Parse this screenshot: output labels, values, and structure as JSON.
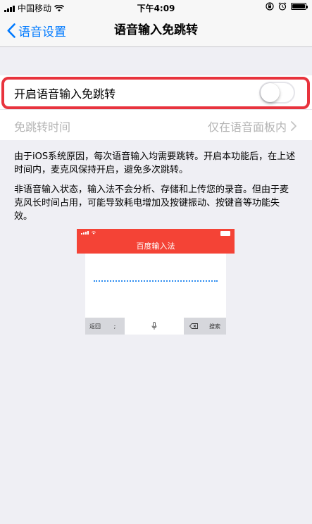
{
  "status_bar": {
    "carrier": "中国移动",
    "time": "下午4:09"
  },
  "nav": {
    "back_label": "语音设置",
    "title": "语音输入免跳转"
  },
  "settings": {
    "toggle_label": "开启语音输入免跳转",
    "toggle_on": false,
    "time_label": "免跳转时间",
    "time_value": "仅在语音面板内"
  },
  "description": {
    "paragraph1": "由于iOS系统原因，每次语音输入均需要跳转。开启本功能后，在上述时间内，麦克风保持开启，避免多次跳转。",
    "paragraph2": "非语音输入状态，输入法不会分析、存储和上传您的录音。但由于麦克风长时间占用，可能导致耗电增加及按键振动、按键音等功能失效。"
  },
  "illustration": {
    "title": "百度输入法",
    "key_back": "返回",
    "key_semicolon": ";",
    "key_search": "搜索"
  },
  "colors": {
    "accent": "#007aff",
    "highlight": "#e8333d",
    "illustration_header": "#f44336",
    "dots": "#2d8cf0"
  }
}
